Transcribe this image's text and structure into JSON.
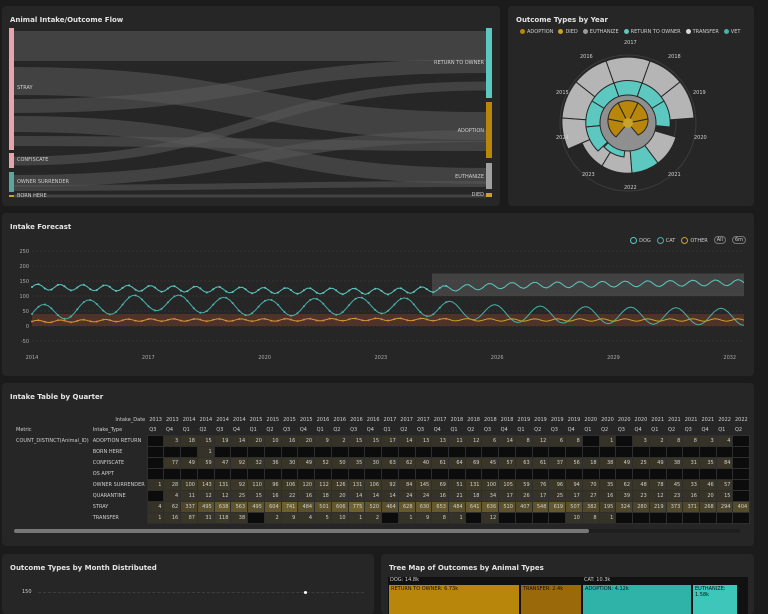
{
  "sankey": {
    "title": "Animal Intake/Outcome Flow",
    "left": [
      "STRAY",
      "CONFISCATE",
      "OWNER SURRENDER",
      "BORN HERE"
    ],
    "right": [
      "RETURN TO OWNER",
      "ADOPTION",
      "EUTHANIZE",
      "DIED"
    ]
  },
  "polar": {
    "title": "Outcome Types by Year",
    "legend": [
      {
        "label": "ADOPTION",
        "color": "#b8860b"
      },
      {
        "label": "DIED",
        "color": "#c9a227"
      },
      {
        "label": "EUTHANIZE",
        "color": "#9a9a9a"
      },
      {
        "label": "RETURN TO OWNER",
        "color": "#5cc8c0"
      },
      {
        "label": "TRANSFER",
        "color": "#d9d9d9"
      },
      {
        "label": "VET",
        "color": "#48b0a8"
      }
    ],
    "years": [
      "2017",
      "2018",
      "2019",
      "2020",
      "2021",
      "2022",
      "2023",
      "2024",
      "2015",
      "2016"
    ]
  },
  "forecast": {
    "title": "Intake Forecast",
    "legend": [
      "DOG",
      "CAT",
      "OTHER"
    ],
    "buttons": [
      "All",
      "6m"
    ],
    "y_ticks": [
      "250",
      "200",
      "150",
      "100",
      "50",
      "0",
      "-50"
    ],
    "x_ticks": [
      "2014",
      "2017",
      "2020",
      "2023",
      "2026",
      "2029",
      "2032"
    ]
  },
  "chart_data": [
    {
      "type": "line",
      "title": "Intake Forecast",
      "x": [
        "2014",
        "2017",
        "2020",
        "2023",
        "2026",
        "2029",
        "2032"
      ],
      "ylim": [
        -50,
        250
      ],
      "series": [
        {
          "name": "DOG",
          "values": [
            130,
            125,
            118,
            115,
            135,
            140,
            145
          ]
        },
        {
          "name": "CAT",
          "values": [
            40,
            80,
            60,
            70,
            40,
            35,
            30
          ]
        },
        {
          "name": "OTHER",
          "values": [
            15,
            20,
            20,
            22,
            20,
            20,
            20
          ]
        }
      ]
    }
  ],
  "table": {
    "title": "Intake Table by Quarter",
    "col_header": "Intake_Date",
    "row_header_1": "Metric",
    "row_header_2": "Intake_Type",
    "metric": "COUNT_DISTINCT(Animal_ID)",
    "years": [
      "2013",
      "2013",
      "2014",
      "2014",
      "2014",
      "2014",
      "2015",
      "2015",
      "2015",
      "2015",
      "2016",
      "2016",
      "2016",
      "2016",
      "2017",
      "2017",
      "2017",
      "2017",
      "2018",
      "2018",
      "2018",
      "2018",
      "2019",
      "2019",
      "2019",
      "2019",
      "2020",
      "2020",
      "2020",
      "2020",
      "2021",
      "2021",
      "2021",
      "2021",
      "2022",
      "2022"
    ],
    "quarters": [
      "Q3",
      "Q4",
      "Q1",
      "Q2",
      "Q3",
      "Q4",
      "Q1",
      "Q2",
      "Q3",
      "Q4",
      "Q1",
      "Q2",
      "Q3",
      "Q4",
      "Q1",
      "Q2",
      "Q3",
      "Q4",
      "Q1",
      "Q2",
      "Q3",
      "Q4",
      "Q1",
      "Q2",
      "Q3",
      "Q4",
      "Q1",
      "Q2",
      "Q3",
      "Q4",
      "Q1",
      "Q2",
      "Q3",
      "Q4",
      "Q1",
      "Q2"
    ],
    "rows": [
      {
        "type": "ADOPTION RETURN",
        "cells": [
          "",
          "3",
          "18",
          "15",
          "19",
          "14",
          "20",
          "10",
          "16",
          "20",
          "9",
          "2",
          "15",
          "15",
          "17",
          "14",
          "13",
          "13",
          "11",
          "12",
          "6",
          "14",
          "8",
          "12",
          "6",
          "8",
          "",
          "1",
          "",
          "3",
          "2",
          "8",
          "8",
          "3",
          "4"
        ]
      },
      {
        "type": "BORN HERE",
        "cells": [
          "",
          "",
          "",
          "1",
          "",
          "",
          "",
          "",
          "",
          "",
          "",
          "",
          "",
          "",
          "",
          "",
          "",
          "",
          "",
          "",
          "",
          "",
          "",
          "",
          "",
          "",
          "",
          "",
          "",
          "",
          "",
          "",
          "",
          "",
          ""
        ]
      },
      {
        "type": "CONFISCATE",
        "cells": [
          "",
          "77",
          "49",
          "59",
          "47",
          "92",
          "32",
          "36",
          "30",
          "49",
          "52",
          "50",
          "35",
          "30",
          "63",
          "62",
          "40",
          "61",
          "64",
          "69",
          "45",
          "57",
          "63",
          "61",
          "37",
          "56",
          "18",
          "38",
          "49",
          "25",
          "49",
          "38",
          "31",
          "35",
          "84"
        ]
      },
      {
        "type": "OS APPT",
        "cells": [
          "",
          "",
          "",
          "",
          "",
          "",
          "",
          "",
          "",
          "",
          "",
          "",
          "",
          "",
          "",
          "",
          "",
          "",
          "",
          "",
          "",
          "",
          "",
          "",
          "",
          "",
          "",
          "",
          "",
          "",
          "",
          "",
          "",
          "",
          ""
        ]
      },
      {
        "type": "OWNER SURRENDER",
        "cells": [
          "1",
          "28",
          "100",
          "143",
          "131",
          "92",
          "110",
          "96",
          "106",
          "120",
          "112",
          "126",
          "131",
          "106",
          "92",
          "84",
          "145",
          "69",
          "51",
          "131",
          "100",
          "105",
          "59",
          "76",
          "96",
          "94",
          "70",
          "35",
          "62",
          "48",
          "78",
          "45",
          "33",
          "46",
          "57"
        ]
      },
      {
        "type": "QUARANTINE",
        "cells": [
          "",
          "4",
          "11",
          "12",
          "12",
          "25",
          "15",
          "16",
          "22",
          "16",
          "18",
          "20",
          "14",
          "14",
          "14",
          "24",
          "24",
          "16",
          "21",
          "18",
          "34",
          "17",
          "26",
          "17",
          "25",
          "17",
          "27",
          "16",
          "39",
          "23",
          "12",
          "23",
          "16",
          "20",
          "15"
        ]
      },
      {
        "type": "STRAY",
        "cells": [
          "4",
          "62",
          "337",
          "495",
          "638",
          "563",
          "495",
          "604",
          "741",
          "484",
          "501",
          "606",
          "775",
          "520",
          "464",
          "628",
          "630",
          "653",
          "484",
          "641",
          "636",
          "510",
          "407",
          "548",
          "619",
          "507",
          "382",
          "195",
          "324",
          "280",
          "219",
          "373",
          "371",
          "268",
          "294",
          "404"
        ]
      },
      {
        "type": "TRANSFER",
        "cells": [
          "1",
          "16",
          "87",
          "31",
          "118",
          "38",
          "",
          "2",
          "9",
          "4",
          "5",
          "10",
          "1",
          "2",
          "",
          "1",
          "9",
          "8",
          "1",
          "",
          "12",
          "",
          "",
          "",
          "",
          "10",
          "8",
          "1",
          "",
          "",
          "",
          "",
          "",
          "",
          ""
        ]
      }
    ]
  },
  "month": {
    "title": "Outcome Types by Month Distributed",
    "y_tick": "150"
  },
  "treemap": {
    "title": "Tree Map of Outcomes by Animal Types",
    "group_dog": "DOG: 14.8k",
    "group_cat": "CAT: 10.3k",
    "cells": [
      "RETURN TO OWNER: 6.73k",
      "TRANSFER: 2.4k",
      "ADOPTION: 4.12k",
      "EUTHANIZE: 1.58k"
    ]
  }
}
